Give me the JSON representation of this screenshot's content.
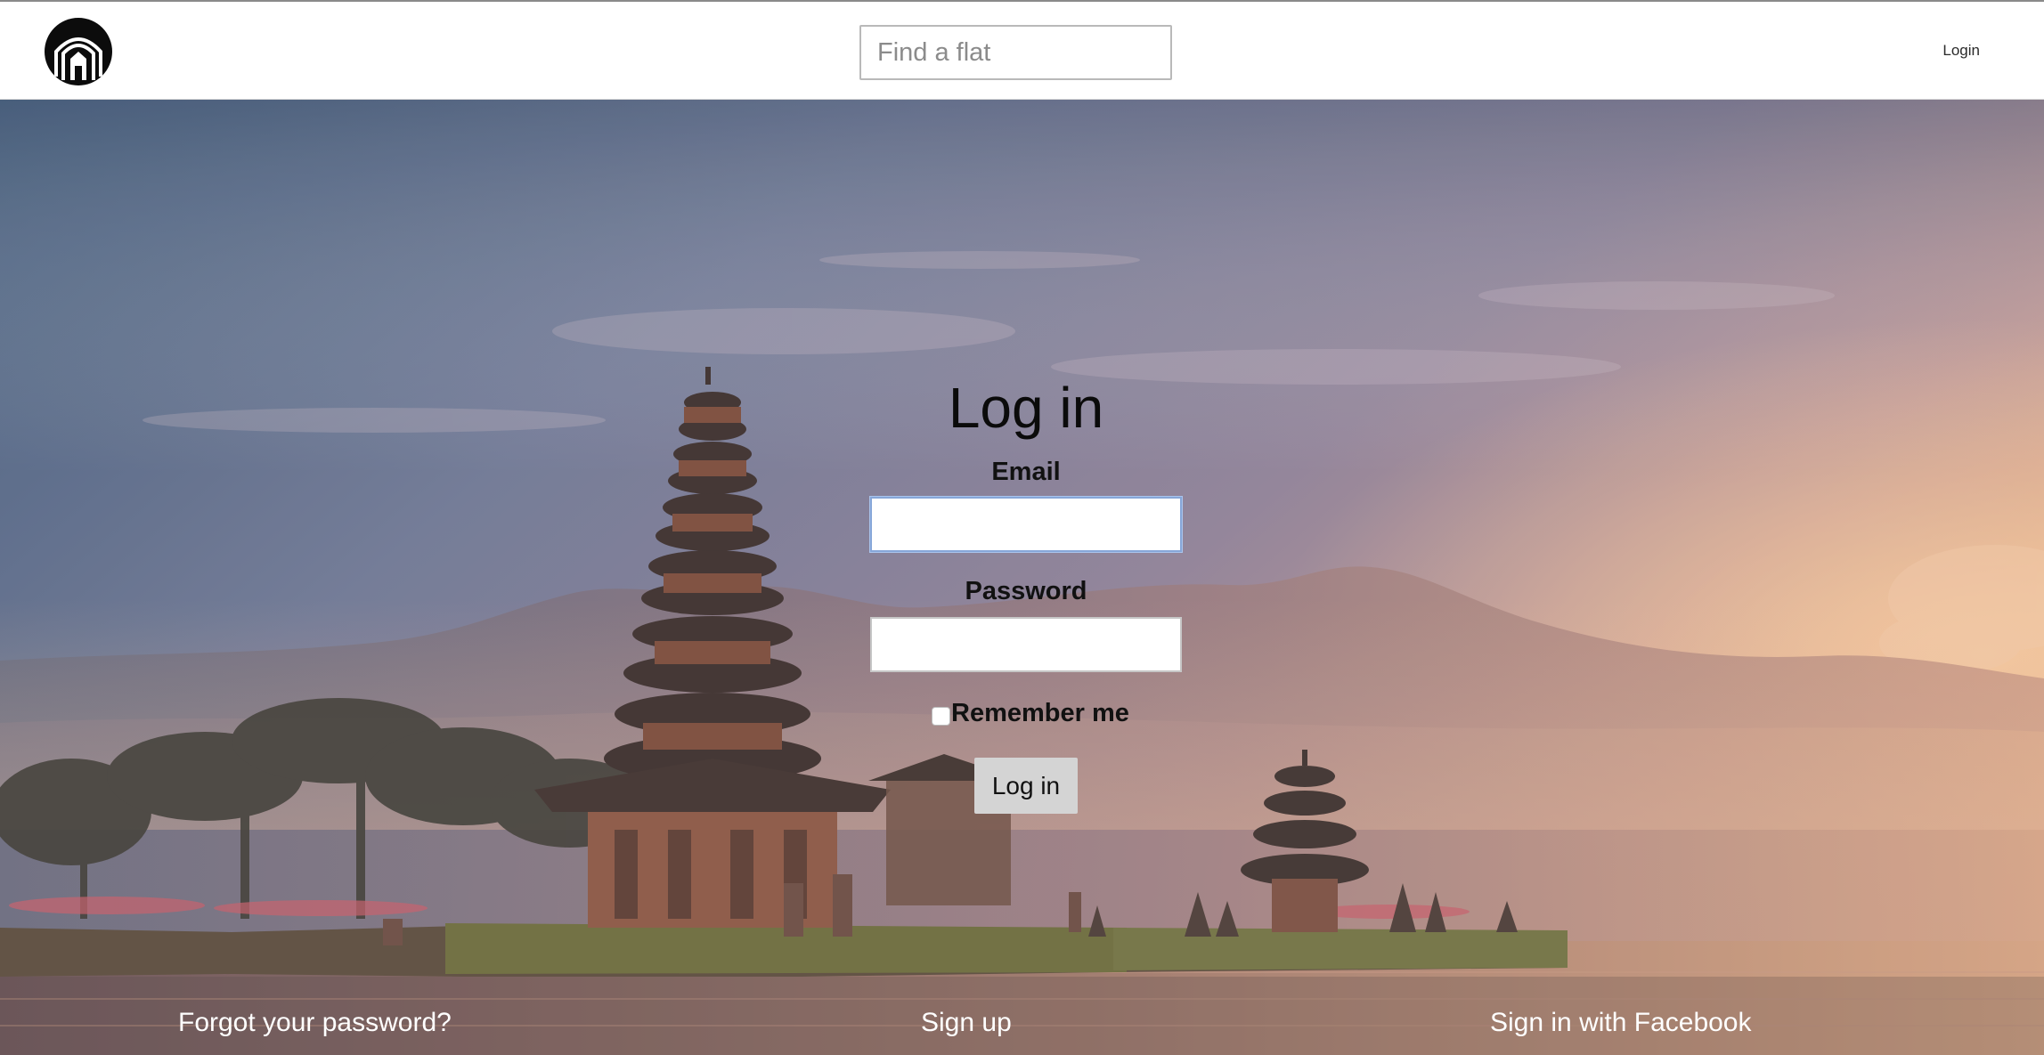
{
  "navbar": {
    "logo_icon": "house-arch-logo-icon",
    "search_placeholder": "Find a flat",
    "login_link": "Login"
  },
  "hero": {
    "image": "temple-on-lake-at-sunset"
  },
  "form": {
    "title": "Log in",
    "email_label": "Email",
    "email_value": "",
    "password_label": "Password",
    "password_value": "",
    "remember_label": "Remember me",
    "remember_checked": false,
    "submit_label": "Log in"
  },
  "footer": {
    "forgot_password": "Forgot your password?",
    "sign_up": "Sign up",
    "facebook": "Sign in with Facebook"
  },
  "colors": {
    "accent_focus": "#86a6d8",
    "button_bg": "#d4d4d4",
    "link_color": "#ffffff"
  }
}
